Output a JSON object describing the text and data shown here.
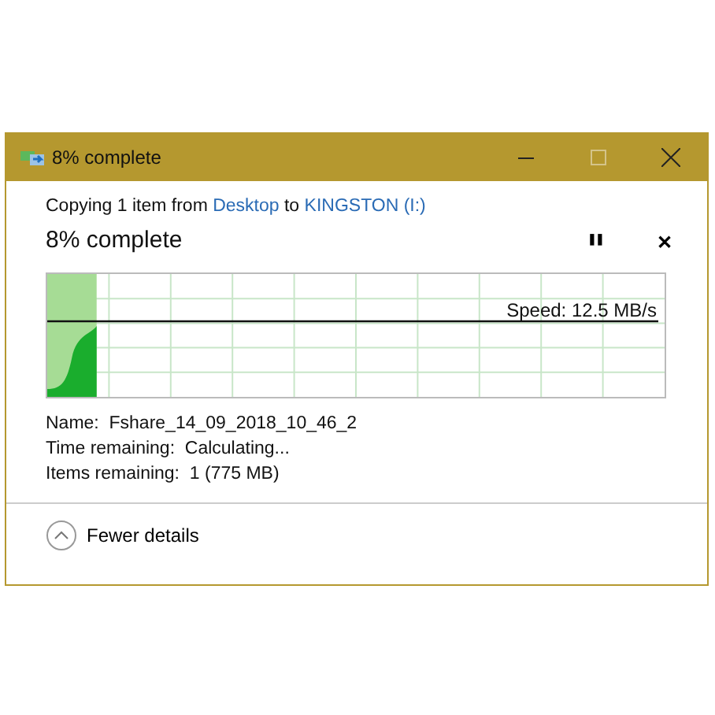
{
  "window": {
    "title": "8% complete",
    "maximize_disabled": true
  },
  "copy": {
    "prefix": "Copying 1 item from",
    "source": "Desktop",
    "joiner": "to",
    "destination": "KINGSTON (I:)"
  },
  "progress": {
    "heading": "8% complete",
    "pause_symbol": "❚❚",
    "cancel_symbol": "✕",
    "level": 0.08,
    "speed": "Speed: 12.5 MB/s"
  },
  "details": [
    {
      "label": "Name:",
      "value": "Fshare_14_09_2018_10_46_2"
    },
    {
      "label": "Time remaining:",
      "value": "Calculating..."
    },
    {
      "label": "Items remaining:",
      "value": "1 (775 MB)"
    }
  ],
  "footer": {
    "label": "Fewer details",
    "expanded": true
  }
}
